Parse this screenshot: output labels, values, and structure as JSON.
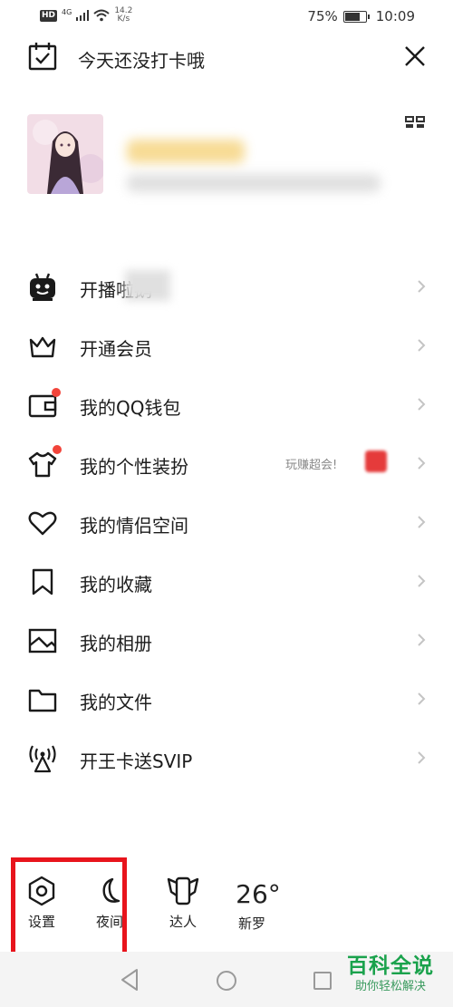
{
  "status_bar": {
    "hd": "HD",
    "network": "4G",
    "speed": "14.2",
    "speed_unit": "K/s",
    "battery_percent": "75%",
    "battery_level": 0.75,
    "time": "10:09"
  },
  "header": {
    "checkin_text": "今天还没打卡哦",
    "calendar_icon": "calendar-check-icon",
    "close_icon": "close-icon"
  },
  "profile": {
    "avatar": "avatar",
    "qr_icon": "qr-code-icon"
  },
  "menu": {
    "items": [
      {
        "label": "开播啦鹅",
        "icon": "live-robot-icon"
      },
      {
        "label": "开通会员",
        "icon": "crown-icon"
      },
      {
        "label": "我的QQ钱包",
        "icon": "wallet-icon",
        "badge_dot": true
      },
      {
        "label": "我的个性装扮",
        "icon": "tshirt-icon",
        "badge_dot": true,
        "promo": "玩赚超会!"
      },
      {
        "label": "我的情侣空间",
        "icon": "heart-icon"
      },
      {
        "label": "我的收藏",
        "icon": "bookmark-icon"
      },
      {
        "label": "我的相册",
        "icon": "photo-album-icon"
      },
      {
        "label": "我的文件",
        "icon": "folder-icon"
      },
      {
        "label": "开王卡送SVIP",
        "icon": "signal-tower-icon"
      }
    ]
  },
  "bottom_bar": {
    "settings": "设置",
    "night": "夜间",
    "expert": "达人",
    "temperature": "26°",
    "city": "新罗"
  },
  "colors": {
    "badge_red": "#f2443a",
    "highlight_red": "#e8141c",
    "watermark_green": "#1aa24c"
  },
  "watermark": {
    "title": "百科全说",
    "subtitle": "助你轻松解决"
  }
}
